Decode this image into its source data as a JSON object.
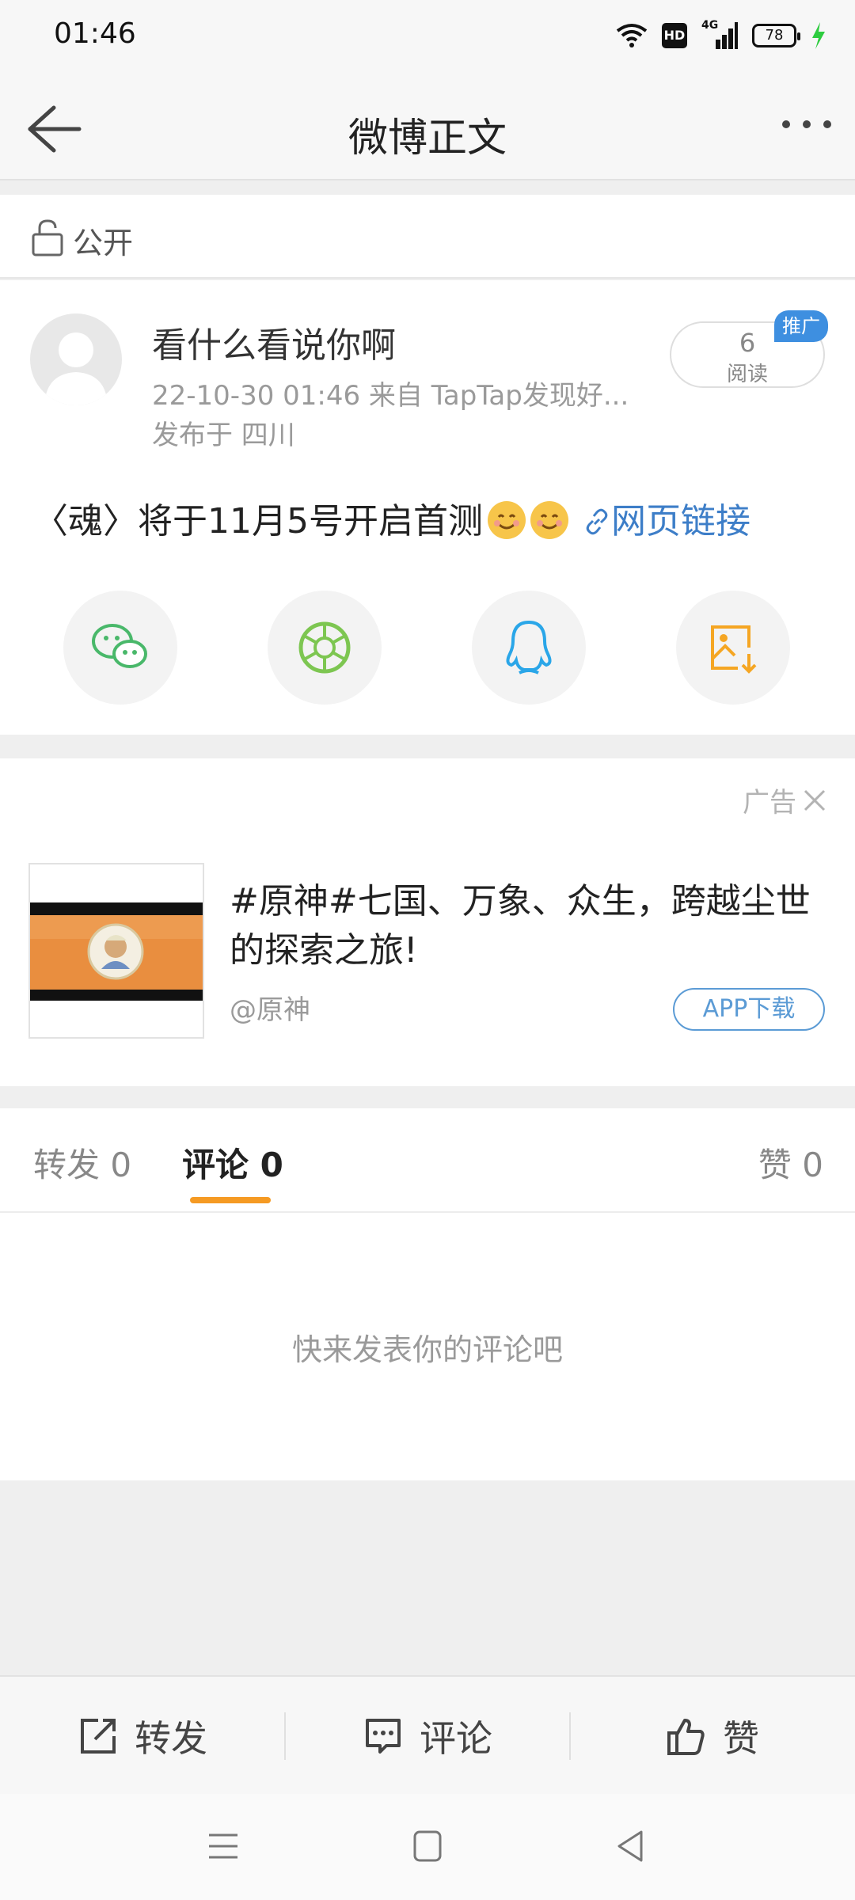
{
  "status_bar": {
    "time": "01:46",
    "battery": "78",
    "network": "4G",
    "hd": "HD",
    "icons": [
      "wifi-icon",
      "hd-icon",
      "signal-icon",
      "battery-icon",
      "charging-icon"
    ]
  },
  "header": {
    "title": "微博正文",
    "back_icon": "arrow-left-icon",
    "more_icon": "more-dots-icon"
  },
  "visibility": {
    "label": "公开",
    "icon": "unlock-icon"
  },
  "post": {
    "username": "看什么看说你啊",
    "meta": "22-10-30 01:46   来自 TapTap发现好...",
    "location": "发布于 四川",
    "reads_count": "6",
    "reads_label": "阅读",
    "promo_badge": "推广",
    "content_text": "〈魂〉将于11月5号开启首测",
    "link_text": "网页链接",
    "share_targets": [
      "wechat-icon",
      "moments-icon",
      "qq-icon",
      "save-image-icon"
    ]
  },
  "ad": {
    "label": "广告",
    "title": "#原神#七国、万象、众生，跨越尘世的探索之旅!",
    "handle": "@原神",
    "download_label": "APP下载"
  },
  "tabs": {
    "repost": "转发 0",
    "comment": "评论 0",
    "like": "赞 0"
  },
  "comments": {
    "empty_text": "快来发表你的评论吧"
  },
  "actions": {
    "repost": "转发",
    "comment": "评论",
    "like": "赞"
  },
  "colors": {
    "accent_orange": "#f59a23",
    "link_blue": "#3d7ec8",
    "promo_blue": "#3e8fe0",
    "wechat_green": "#49b86a",
    "qq_blue": "#2aa6e8",
    "save_orange": "#f5a623"
  }
}
